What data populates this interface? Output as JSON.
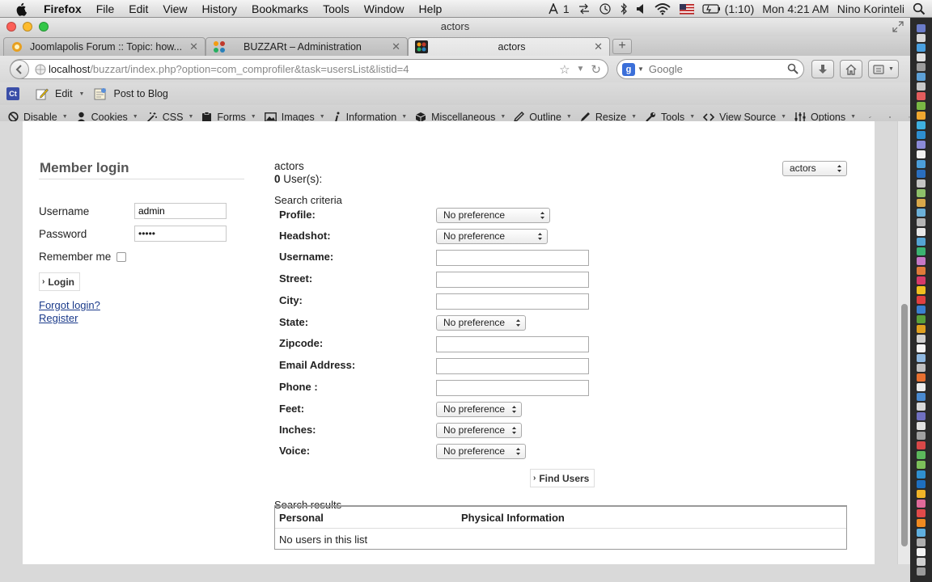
{
  "menubar": {
    "app": "Firefox",
    "items": [
      "File",
      "Edit",
      "View",
      "History",
      "Bookmarks",
      "Tools",
      "Window",
      "Help"
    ],
    "keyboard_indicator": "1",
    "battery": "(1:10)",
    "clock": "Mon 4:21 AM",
    "user": "Nino Korinteli"
  },
  "window": {
    "title": "actors"
  },
  "tabs": [
    {
      "label": "Joomlapolis Forum :: Topic: how...",
      "close": "✕",
      "icon_color": "#e8a020"
    },
    {
      "label": "BUZZARt – Administration",
      "close": "✕",
      "icon_color": "#c0392b"
    },
    {
      "label": "actors",
      "close": "✕",
      "icon_color": "#2a2a2a"
    }
  ],
  "newtab": "+",
  "address": {
    "host": "localhost",
    "path": "/buzzart/index.php?option=com_comprofiler&task=usersList&listid=4"
  },
  "search": {
    "placeholder": "Google",
    "engine_letter": "g"
  },
  "bookmarks": {
    "edit": "Edit",
    "post": "Post to Blog"
  },
  "webdev": [
    "Disable",
    "Cookies",
    "CSS",
    "Forms",
    "Images",
    "Information",
    "Miscellaneous",
    "Outline",
    "Resize",
    "Tools",
    "View Source",
    "Options"
  ],
  "login": {
    "title": "Member login",
    "username_label": "Username",
    "username_value": "admin",
    "password_label": "Password",
    "password_value": "•••••",
    "remember_label": "Remember me",
    "login_button": "Login",
    "forgot_link": "Forgot login?",
    "register_link": "Register"
  },
  "list": {
    "name": "actors",
    "count": "0",
    "count_suffix": " User(s):",
    "selector_value": "actors",
    "search_criteria": "Search criteria",
    "fields": [
      {
        "label": "Profile:",
        "type": "select",
        "value": "No preference"
      },
      {
        "label": "Headshot:",
        "type": "select",
        "value": "No preference"
      },
      {
        "label": "Username:",
        "type": "text"
      },
      {
        "label": "Street:",
        "type": "text"
      },
      {
        "label": "City:",
        "type": "text"
      },
      {
        "label": "State:",
        "type": "select",
        "value": "No preference"
      },
      {
        "label": "Zipcode:",
        "type": "text"
      },
      {
        "label": "Email Address:",
        "type": "text"
      },
      {
        "label": "Phone :",
        "type": "text"
      },
      {
        "label": "Feet:",
        "type": "select",
        "value": "No preference"
      },
      {
        "label": "Inches:",
        "type": "select",
        "value": "No preference"
      },
      {
        "label": "Voice:",
        "type": "select",
        "value": "No preference"
      }
    ],
    "find_button": "Find Users",
    "results_label": "Search results",
    "columns": [
      "Personal",
      "Physical Information"
    ],
    "empty_message": "No users in this list"
  },
  "colors": {
    "link": "#1a3a8a",
    "page": "#ffffff",
    "chrome": "#d9d9d9"
  }
}
